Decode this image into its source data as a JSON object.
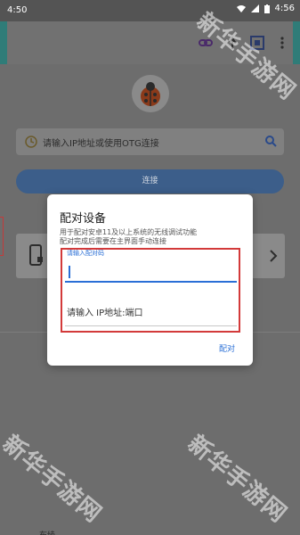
{
  "status_bar": {
    "time_left": "4:50",
    "time_right": "4:56"
  },
  "main": {
    "search_placeholder": "请输入IP地址或使用OTG连接",
    "connect_button": "连接",
    "bottom_label": "布绫"
  },
  "dialog": {
    "title": "配对设备",
    "description": "用于配对安卓11及以上系统的无线调试功能\n配对完成后需要在主界面手动连接",
    "pairing_code_label": "请输入配对码",
    "ip_placeholder": "请输入 IP地址:端口",
    "ok_button": "配对"
  },
  "watermark": {
    "text": "新华手游网"
  },
  "colors": {
    "accent": "#2a6fd6",
    "highlight_box": "#d33a3a",
    "toolbar_teal": "#2f7c78"
  }
}
